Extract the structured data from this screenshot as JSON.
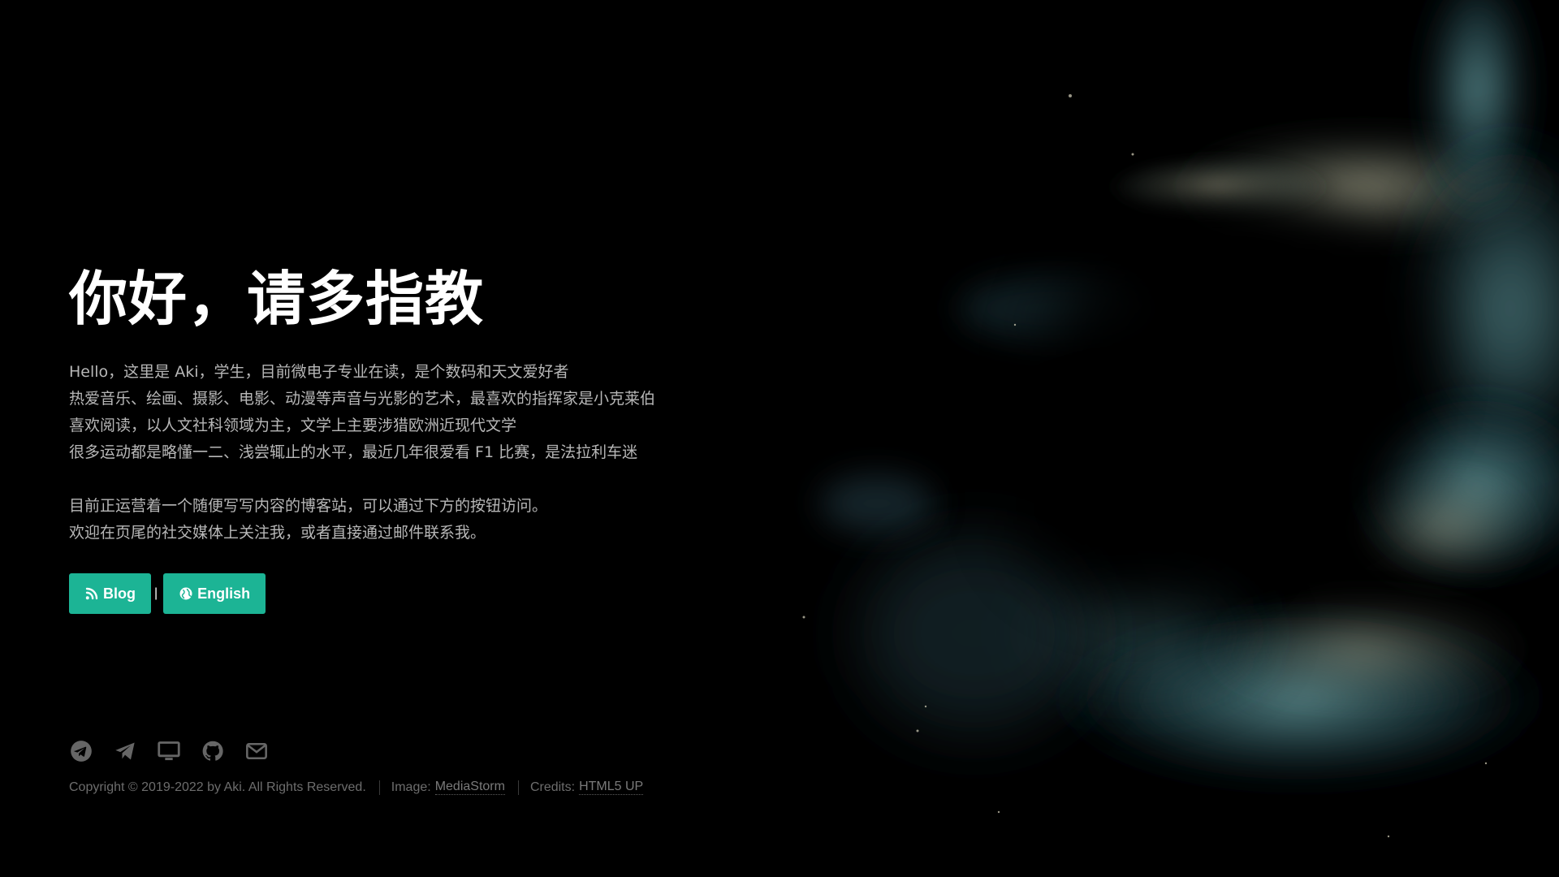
{
  "hero": {
    "title": "你好，请多指教",
    "intro_lines": [
      "Hello，这里是 Aki，学生，目前微电子专业在读，是个数码和天文爱好者",
      "热爱音乐、绘画、摄影、电影、动漫等声音与光影的艺术，最喜欢的指挥家是小克莱伯",
      "喜欢阅读，以人文社科领域为主，文学上主要涉猎欧洲近现代文学",
      "很多运动都是略懂一二、浅尝辄止的水平，最近几年很爱看 F1 比赛，是法拉利车迷"
    ],
    "note_lines": [
      "目前正运营着一个随便写写内容的博客站，可以通过下方的按钮访问。",
      "欢迎在页尾的社交媒体上关注我，或者直接通过邮件联系我。"
    ]
  },
  "buttons": {
    "blog_label": "Blog",
    "separator": "|",
    "english_label": "English"
  },
  "social_icons": [
    "telegram-icon",
    "send-icon",
    "monitor-icon",
    "github-icon",
    "mail-icon"
  ],
  "footer": {
    "copyright": "Copyright © 2019-2022 by Aki. All Rights Reserved.",
    "image_prefix": "Image:",
    "image_link": "MediaStorm",
    "credits_prefix": "Credits:",
    "credits_link": "HTML5 UP"
  },
  "colors": {
    "background": "#000000",
    "accent": "#1cb495",
    "title": "#ffffff",
    "body_text": "#b7b7b7",
    "footer_text": "#6d6d6d"
  }
}
